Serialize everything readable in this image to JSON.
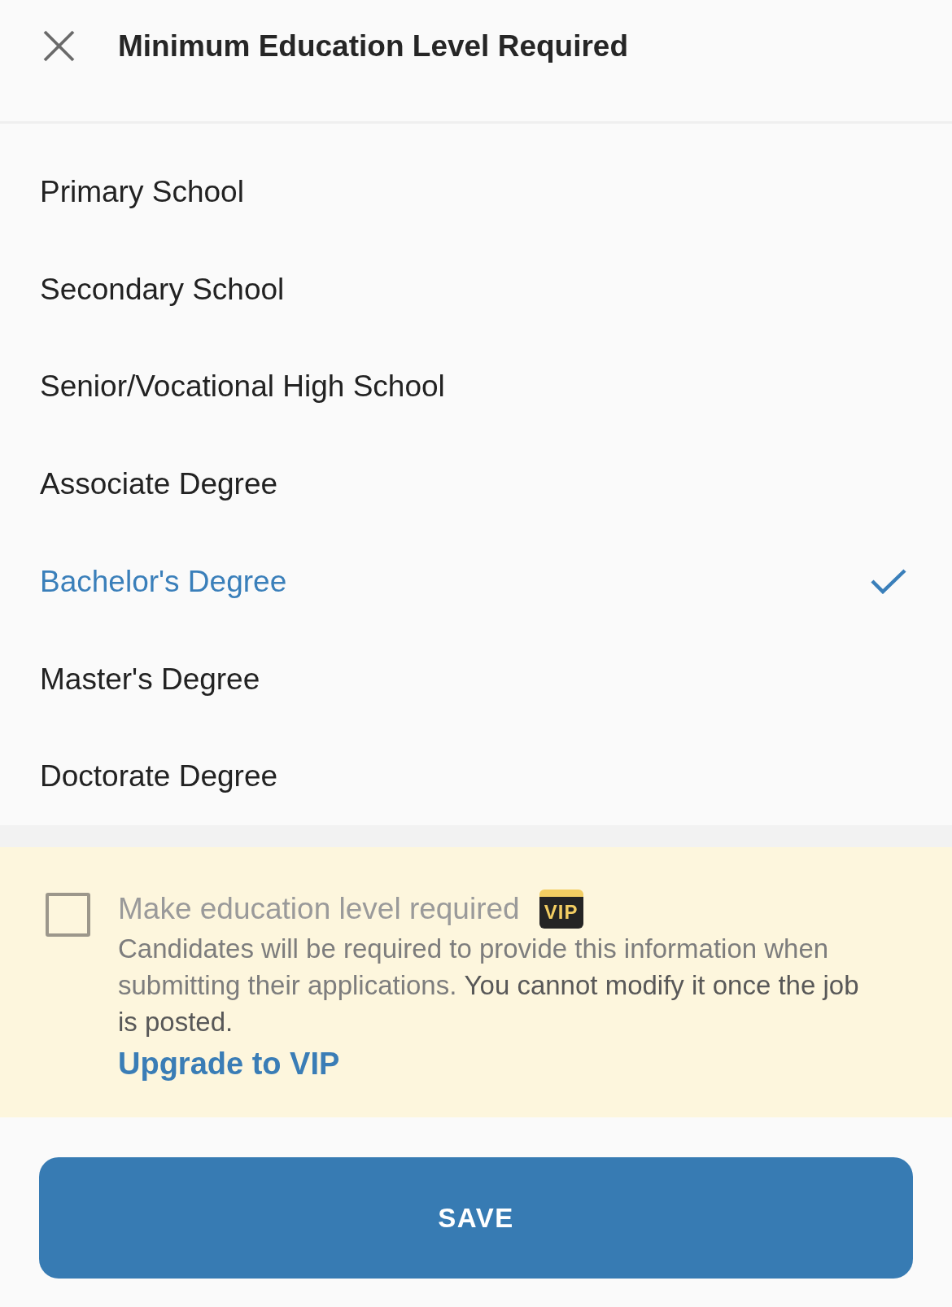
{
  "header": {
    "title": "Minimum Education Level Required"
  },
  "options": [
    {
      "label": "Primary School",
      "selected": false
    },
    {
      "label": "Secondary School",
      "selected": false
    },
    {
      "label": "Senior/Vocational High School",
      "selected": false
    },
    {
      "label": "Associate Degree",
      "selected": false
    },
    {
      "label": "Bachelor's Degree",
      "selected": true
    },
    {
      "label": "Master's Degree",
      "selected": false
    },
    {
      "label": "Doctorate Degree",
      "selected": false
    }
  ],
  "requirement": {
    "checked": false,
    "disabled": true,
    "label": "Make education level required",
    "badge": "VIP",
    "description": "Candidates will be required to provide this information when submitting their applications. **You cannot modify it once the job is posted.**",
    "link": "Upgrade to VIP"
  },
  "save_button": {
    "label": "SAVE"
  }
}
